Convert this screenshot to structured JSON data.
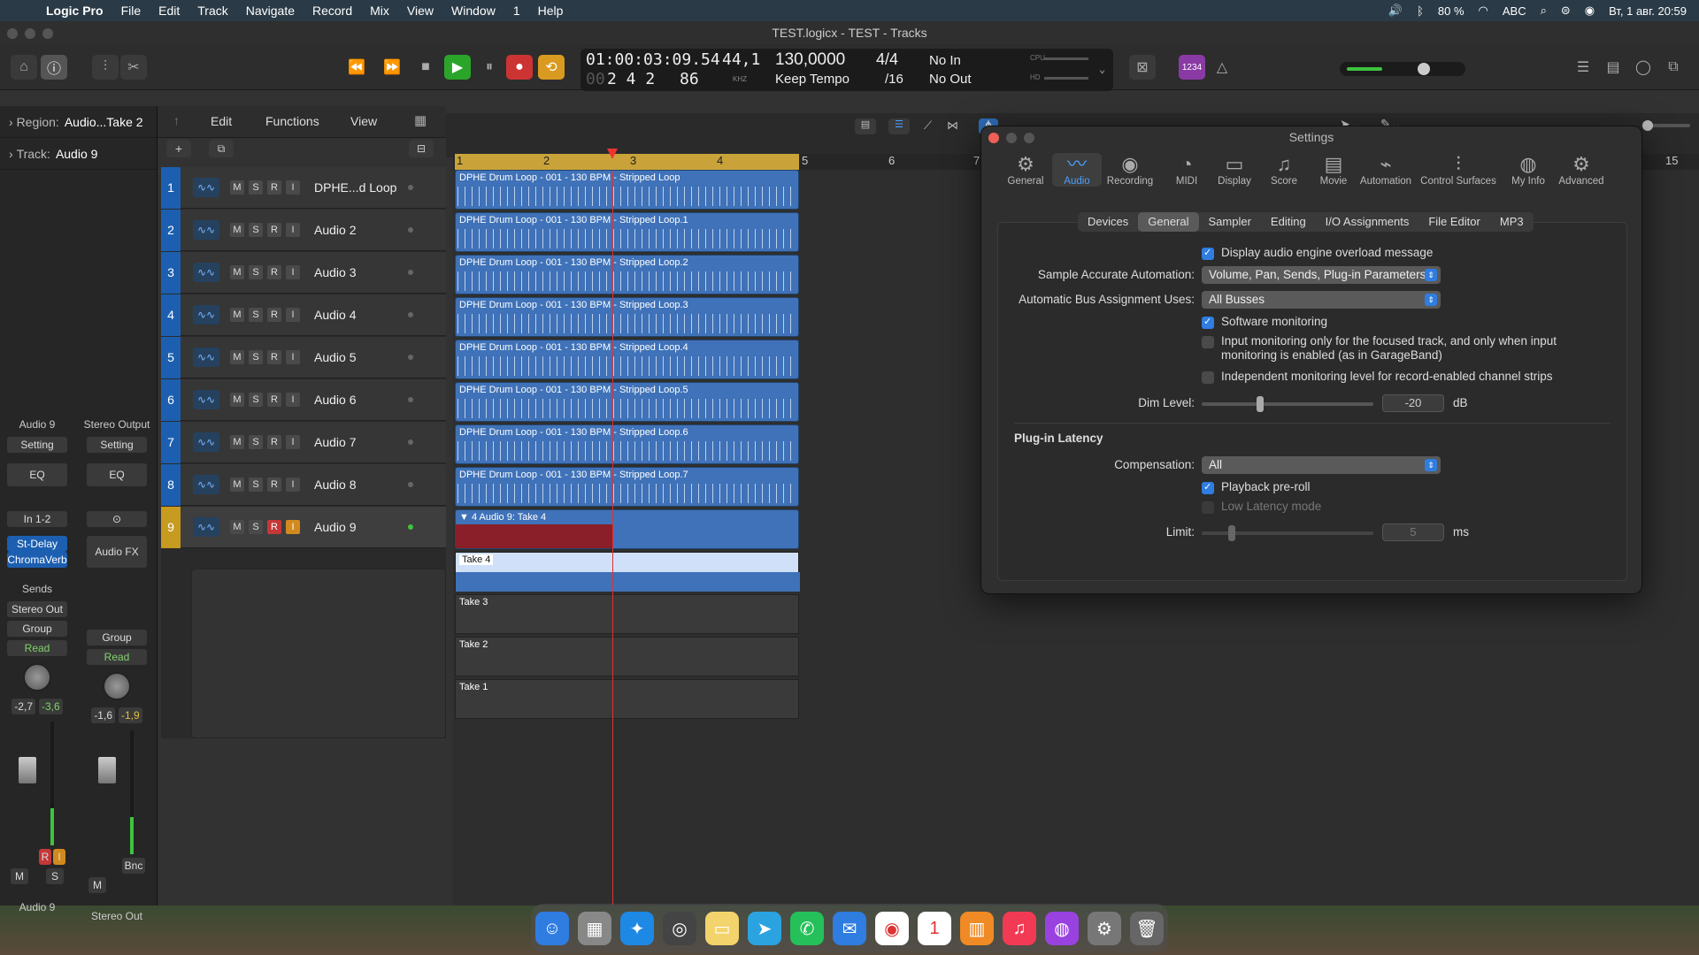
{
  "menubar": {
    "app": "Logic Pro",
    "items": [
      "File",
      "Edit",
      "Track",
      "Navigate",
      "Record",
      "Mix",
      "View",
      "Window",
      "1",
      "Help"
    ],
    "battery": "80 %",
    "input": "ABC",
    "datetime": "Вт, 1 авг. 20:59"
  },
  "window": {
    "title": "TEST.logicx - TEST - Tracks"
  },
  "lcd": {
    "time": "01:00:03:09.54",
    "bars_dim": "00",
    "bars": "2 4 2",
    "bars_sub": "86",
    "sample_rate": "44,1",
    "khz": "KHZ",
    "tempo": "130,0000",
    "tempo_mode": "Keep Tempo",
    "signature": "4/4",
    "division": "/16",
    "input": "No In",
    "output": "No Out",
    "cpu": "CPU",
    "hd": "HD",
    "key_badge": "1234"
  },
  "inspector": {
    "region_label": "Region:",
    "region_name": "Audio...Take 2",
    "track_label": "Track:",
    "track_name": "Audio 9"
  },
  "header_menus": [
    "Edit",
    "Functions",
    "View"
  ],
  "strips": [
    {
      "name": "Audio 9",
      "setting": "Setting",
      "eq": "EQ",
      "io": "In 1-2",
      "fx1": "St-Delay",
      "fx2": "ChromaVerb",
      "sends": "Sends",
      "out": "Stereo Out",
      "group": "Group",
      "auto": "Read",
      "vol": "-2,7",
      "peak": "-3,6",
      "bottom": "Audio 9",
      "r": "R",
      "i": "I",
      "m": "M",
      "s": "S",
      "meter": 0.3
    },
    {
      "name": "Stereo Output",
      "setting": "Setting",
      "eq": "EQ",
      "fx": "Audio FX",
      "group": "Group",
      "auto": "Read",
      "vol": "-1,6",
      "peak": "-1,9",
      "bottom": "Stereo Out",
      "bnc": "Bnc",
      "m": "M",
      "meter": 0.3
    }
  ],
  "tracks": [
    {
      "num": "1",
      "name": "DPHE...d Loop",
      "region": "DPHE Drum Loop - 001 - 130 BPM - Stripped Loop"
    },
    {
      "num": "2",
      "name": "Audio 2",
      "region": "DPHE Drum Loop - 001 - 130 BPM - Stripped Loop.1"
    },
    {
      "num": "3",
      "name": "Audio 3",
      "region": "DPHE Drum Loop - 001 - 130 BPM - Stripped Loop.2"
    },
    {
      "num": "4",
      "name": "Audio 4",
      "region": "DPHE Drum Loop - 001 - 130 BPM - Stripped Loop.3"
    },
    {
      "num": "5",
      "name": "Audio 5",
      "region": "DPHE Drum Loop - 001 - 130 BPM - Stripped Loop.4"
    },
    {
      "num": "6",
      "name": "Audio 6",
      "region": "DPHE Drum Loop - 001 - 130 BPM - Stripped Loop.5"
    },
    {
      "num": "7",
      "name": "Audio 7",
      "region": "DPHE Drum Loop - 001 - 130 BPM - Stripped Loop.6"
    },
    {
      "num": "8",
      "name": "Audio 8",
      "region": "DPHE Drum Loop - 001 - 130 BPM - Stripped Loop.7"
    },
    {
      "num": "9",
      "name": "Audio 9",
      "region": "▼ 4  Audio 9: Take 4"
    }
  ],
  "track_buttons": {
    "m": "M",
    "s": "S",
    "r": "R",
    "i": "I"
  },
  "takes": [
    "Take 4",
    "Take 3",
    "Take 2",
    "Take 1"
  ],
  "ruler": [
    "1",
    "2",
    "3",
    "4",
    "5",
    "6",
    "7",
    "15"
  ],
  "settings": {
    "title": "Settings",
    "tabs": [
      {
        "label": "General",
        "icon": "⚙"
      },
      {
        "label": "Audio",
        "icon": "〰"
      },
      {
        "label": "Recording",
        "icon": "◉"
      },
      {
        "label": "MIDI",
        "icon": "◔"
      },
      {
        "label": "Display",
        "icon": "▭"
      },
      {
        "label": "Score",
        "icon": "♫"
      },
      {
        "label": "Movie",
        "icon": "▤"
      },
      {
        "label": "Automation",
        "icon": "⌁"
      },
      {
        "label": "Control Surfaces",
        "icon": "⫶"
      },
      {
        "label": "My Info",
        "icon": "◍"
      },
      {
        "label": "Advanced",
        "icon": "⚙"
      }
    ],
    "subtabs": [
      "Devices",
      "General",
      "Sampler",
      "Editing",
      "I/O Assignments",
      "File Editor",
      "MP3"
    ],
    "overload": "Display audio engine overload message",
    "sample_label": "Sample Accurate Automation:",
    "sample_value": "Volume, Pan, Sends, Plug-in Parameters",
    "bus_label": "Automatic Bus Assignment Uses:",
    "bus_value": "All Busses",
    "software_monitoring": "Software monitoring",
    "input_monitoring_1": "Input monitoring only for the focused track, and only when input",
    "input_monitoring_2": "monitoring is enabled (as in GarageBand)",
    "independent": "Independent monitoring level for record-enabled channel strips",
    "dim_label": "Dim Level:",
    "dim_value": "-20",
    "dim_unit": "dB",
    "latency_header": "Plug-in Latency",
    "comp_label": "Compensation:",
    "comp_value": "All",
    "preroll": "Playback pre-roll",
    "low_latency": "Low Latency mode",
    "limit_label": "Limit:",
    "limit_value": "5",
    "limit_unit": "ms"
  }
}
